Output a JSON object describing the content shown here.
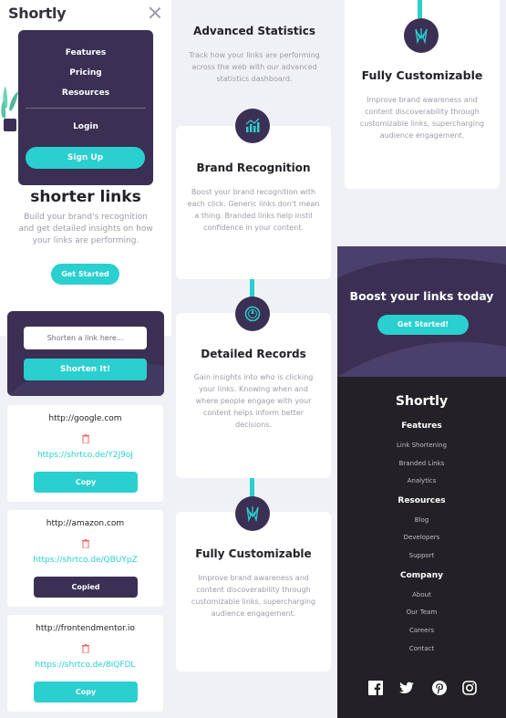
{
  "colors": {
    "cyan": "#2acfcf",
    "dark_violet": "#3b3054",
    "very_dark": "#232127",
    "gray": "#9e9aa8",
    "bg": "#f0f1f6"
  },
  "header": {
    "logo": "Shortly",
    "close_icon": "close-icon"
  },
  "nav_menu": {
    "items": [
      "Features",
      "Pricing",
      "Resources"
    ],
    "login": "Login",
    "signup": "Sign Up"
  },
  "hero": {
    "title": "shorter links",
    "subtitle": "Build your brand's recognition and get detailed insights on how your links are performing.",
    "cta": "Get Started"
  },
  "shortener": {
    "placeholder": "Shorten a link here...",
    "button": "Shorten It!"
  },
  "results": [
    {
      "original": "http://google.com",
      "short": "https://shrtco.de/Y2J9oJ",
      "button": "Copy",
      "copied": false
    },
    {
      "original": "http://amazon.com",
      "short": "https://shrtco.de/QBUYpZ",
      "button": "Copied",
      "copied": true
    },
    {
      "original": "http://frontendmentor.io",
      "short": "https://shrtco.de/8IQFDL",
      "button": "Copy",
      "copied": false
    }
  ],
  "stats": {
    "title": "Advanced Statistics",
    "description": "Track how your links are performing across the web with our advanced statistics dashboard.",
    "cards": [
      {
        "title": "Brand Recognition",
        "icon": "brand-recognition-icon",
        "description": "Boost your brand recognition with each click. Generic links don't mean a thing. Branded links help instil confidence in your content."
      },
      {
        "title": "Detailed Records",
        "icon": "detailed-records-icon",
        "description": "Gain insights into who is clicking your links. Knowing when and where people engage with your content helps inform better decisions."
      },
      {
        "title": "Fully Customizable",
        "icon": "fully-customizable-icon",
        "description": "Improve brand awareness and content discoverability through customizable links, supercharging audience engagement."
      }
    ]
  },
  "column3_card": {
    "title": "Fully Customizable",
    "icon": "fully-customizable-icon",
    "description": "Improve brand awareness and content discoverability through customizable links, supercharging audience engagement."
  },
  "boost": {
    "title": "Boost your links today",
    "button": "Get Started!"
  },
  "footer": {
    "logo": "Shortly",
    "groups": [
      {
        "heading": "Features",
        "links": [
          "Link Shortening",
          "Branded Links",
          "Analytics"
        ]
      },
      {
        "heading": "Resources",
        "links": [
          "Blog",
          "Developers",
          "Support"
        ]
      },
      {
        "heading": "Company",
        "links": [
          "About",
          "Our Team",
          "Careers",
          "Contact"
        ]
      }
    ],
    "social_icons": [
      "facebook-icon",
      "twitter-icon",
      "pinterest-icon",
      "instagram-icon"
    ]
  }
}
